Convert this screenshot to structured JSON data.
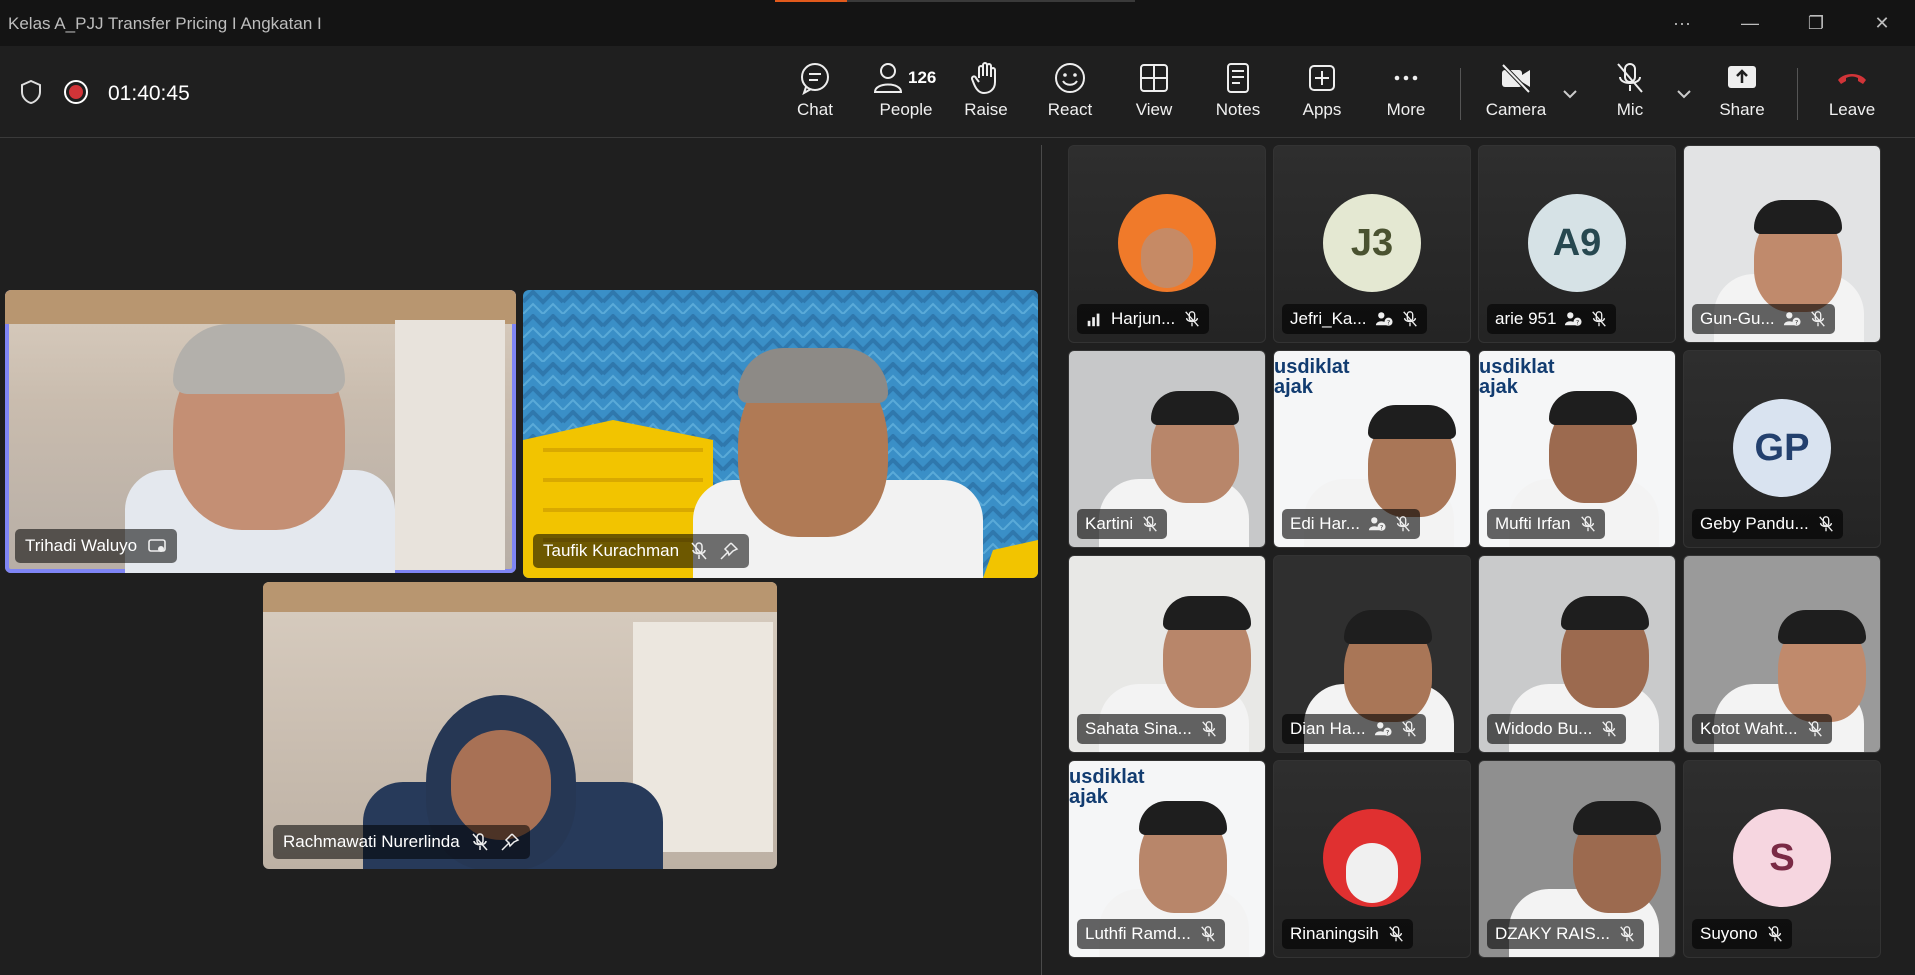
{
  "window": {
    "title": "Kelas A_PJJ Transfer Pricing I Angkatan I",
    "more_glyph": "···",
    "minimize_glyph": "—",
    "restore_glyph": "❐",
    "close_glyph": "✕"
  },
  "meeting": {
    "elapsed": "01:40:45",
    "recording": true
  },
  "toolbar": {
    "chat": "Chat",
    "people": "People",
    "people_count": "126",
    "raise": "Raise",
    "react": "React",
    "view": "View",
    "notes": "Notes",
    "apps": "Apps",
    "more": "More",
    "camera": "Camera",
    "mic": "Mic",
    "share": "Share",
    "leave": "Leave"
  },
  "colors": {
    "accent": "#7f85f5",
    "leave": "#d13438",
    "record": "#d13438",
    "background": "#1f1f1f"
  },
  "stage": [
    {
      "name": "Trihadi Waluyo",
      "active_speaker": true,
      "icon": "screen-share-icon"
    },
    {
      "name": "Taufik Kurachman",
      "muted": true,
      "pinned": true
    },
    {
      "name": "Rachmawati Nurerlinda",
      "muted": true,
      "pinned": true
    }
  ],
  "gallery": [
    {
      "name": "Harjun...",
      "type": "photo-avatar",
      "muted": true,
      "signal": true
    },
    {
      "name": "Jefri_Ka...",
      "type": "initials",
      "initials": "J3",
      "muted": true,
      "guest": true
    },
    {
      "name": "arie 951",
      "type": "initials",
      "initials": "A9",
      "muted": true,
      "guest": true
    },
    {
      "name": "Gun-Gu...",
      "type": "video",
      "muted": true,
      "guest": true
    },
    {
      "name": "Kartini",
      "type": "video",
      "muted": true
    },
    {
      "name": "Edi Har...",
      "type": "video",
      "muted": true,
      "guest": true,
      "brand": "usdiklat\najak"
    },
    {
      "name": "Mufti Irfan",
      "type": "video",
      "muted": true,
      "brand": "usdiklat\najak"
    },
    {
      "name": "Geby Pandu...",
      "type": "initials",
      "initials": "GP",
      "muted": true
    },
    {
      "name": "Sahata Sina...",
      "type": "video",
      "muted": true
    },
    {
      "name": "Dian Ha...",
      "type": "video",
      "muted": true,
      "guest": true
    },
    {
      "name": "Widodo Bu...",
      "type": "video",
      "muted": true
    },
    {
      "name": "Kotot Waht...",
      "type": "video",
      "muted": true
    },
    {
      "name": "Luthfi Ramd...",
      "type": "video",
      "muted": true,
      "brand": "usdiklat\najak"
    },
    {
      "name": "Rinaningsih",
      "type": "photo-avatar",
      "muted": true
    },
    {
      "name": "DZAKY RAIS...",
      "type": "video",
      "muted": true
    },
    {
      "name": "Suyono",
      "type": "initials",
      "initials": "S",
      "muted": true
    }
  ],
  "brand_text": {
    "line1": "usdiklat",
    "line2": "ajak"
  }
}
